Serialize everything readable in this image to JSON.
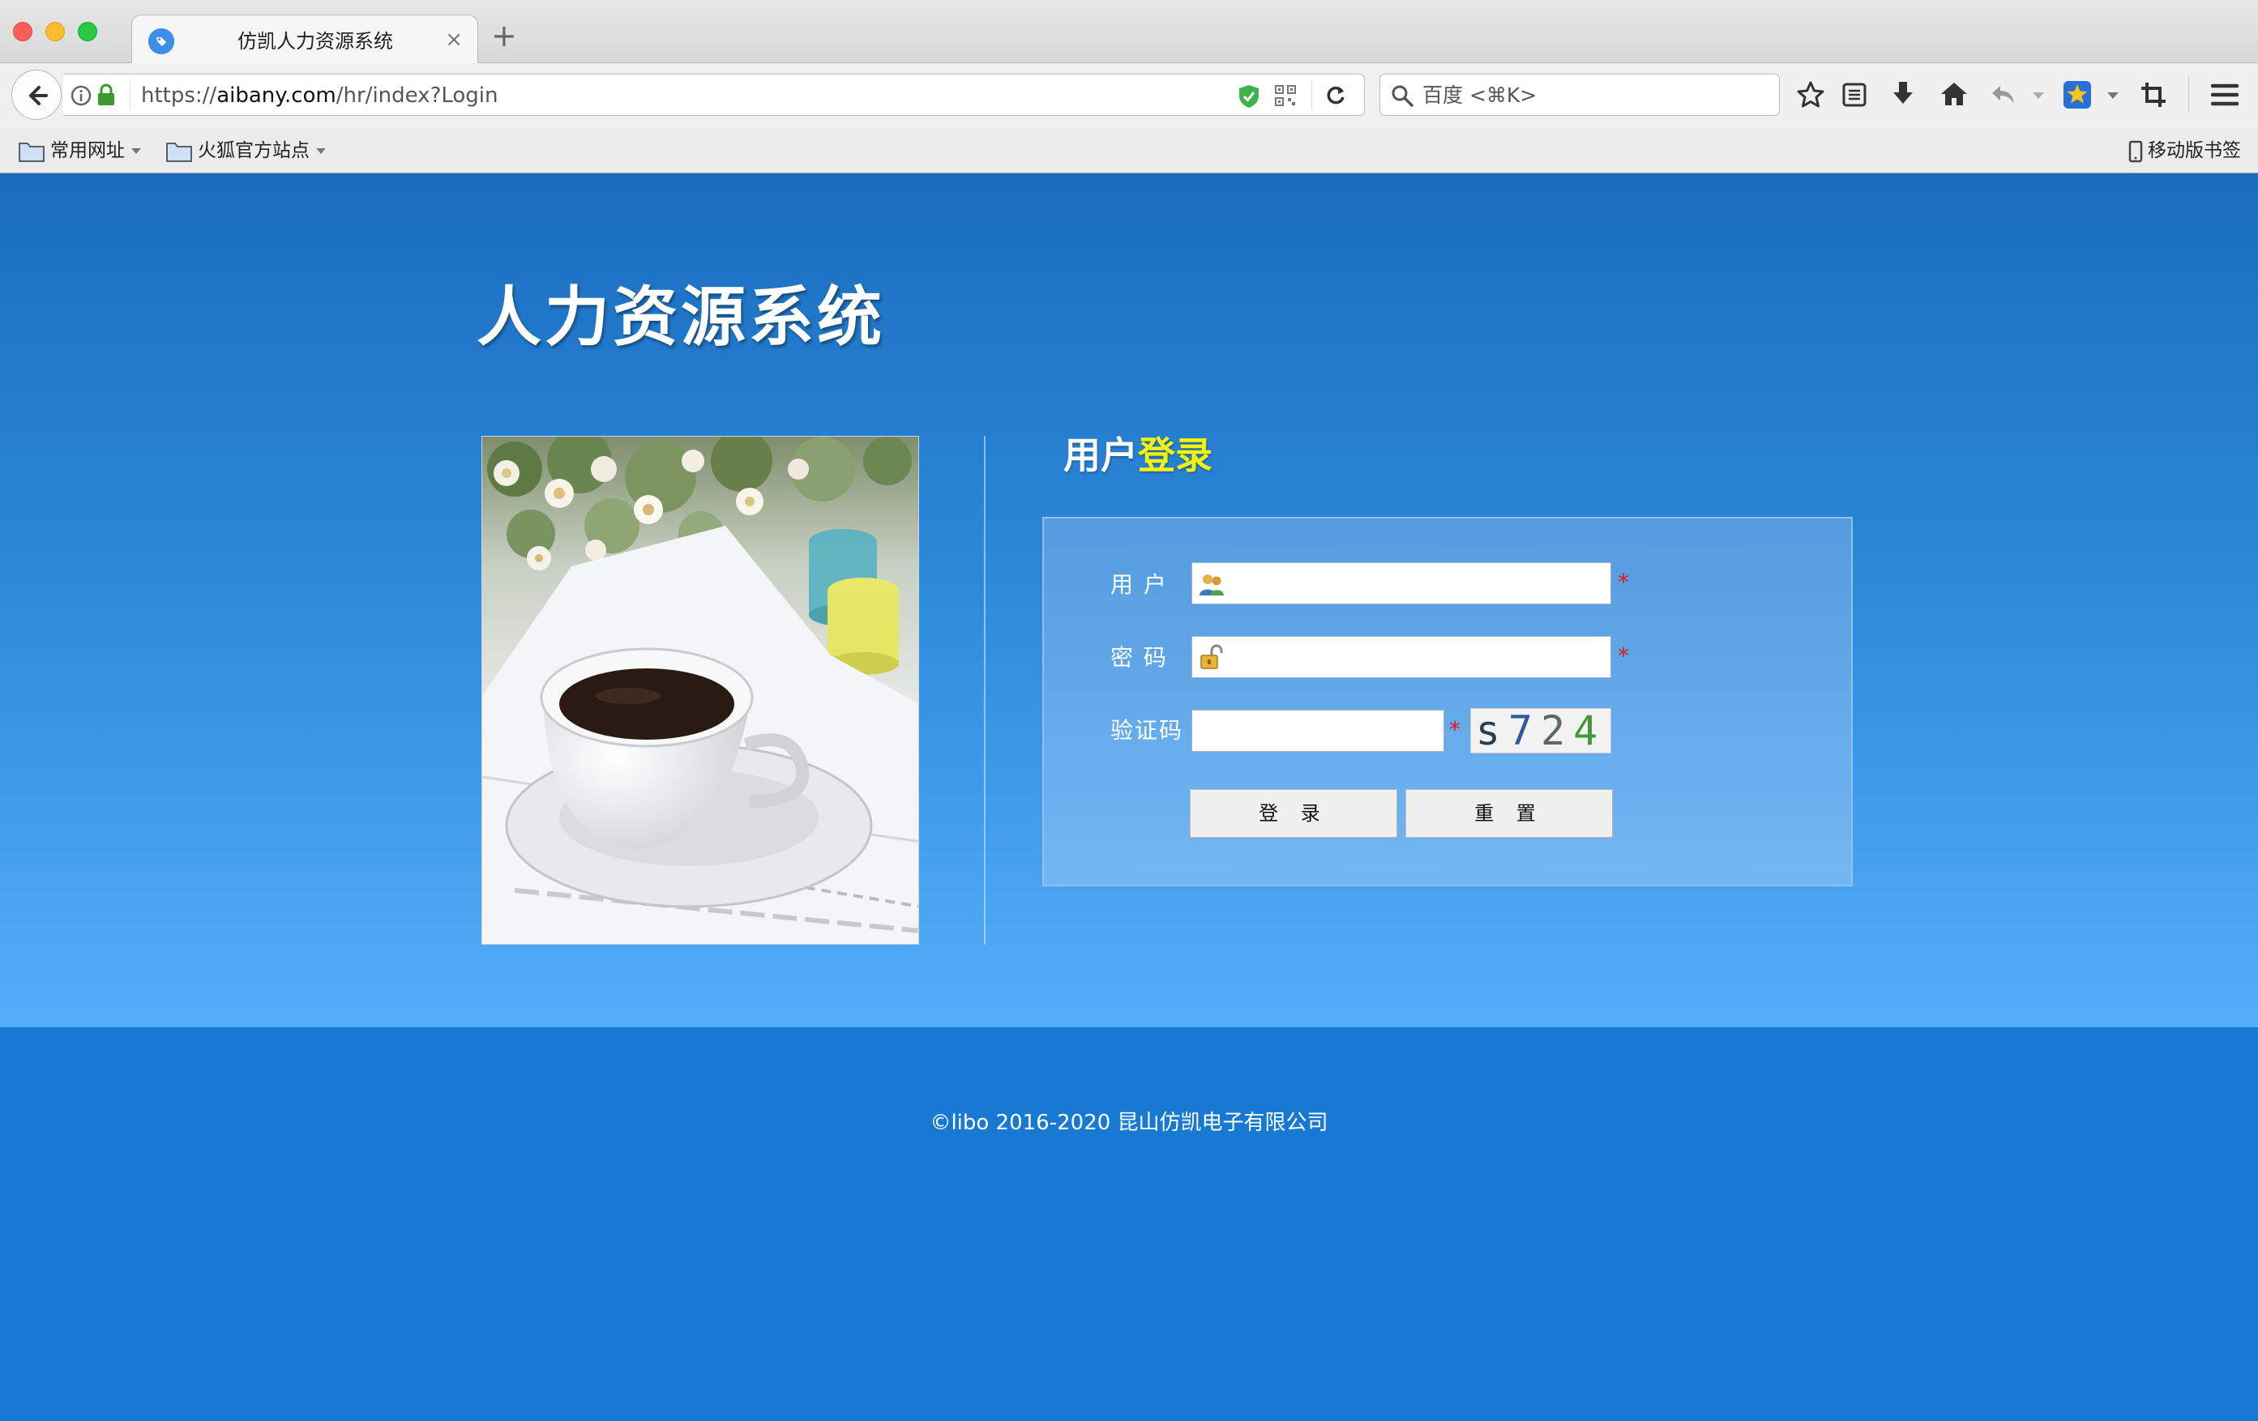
{
  "browser": {
    "tab_title": "仿凯人力资源系统",
    "tab_close": "×",
    "new_tab": "+",
    "url_prefix": "https://",
    "url_domain": "aibany.com",
    "url_path": "/hr/index?Login",
    "search_placeholder": "百度 <⌘K>",
    "bookmarks": [
      {
        "label": "常用网址"
      },
      {
        "label": "火狐官方站点"
      }
    ],
    "mobile_bookmarks": "移动版书签"
  },
  "page": {
    "app_title": "人力资源系统",
    "login_heading_part1": "用户",
    "login_heading_part2": "登录",
    "fields": {
      "username_label": "用 户",
      "password_label": "密 码",
      "captcha_label": "验证码",
      "required_mark": "*"
    },
    "captcha": {
      "c1": "s",
      "c2": "7",
      "c3": "2",
      "c4": "4"
    },
    "buttons": {
      "login": "登 录",
      "reset": "重 置"
    },
    "footer_text": "©libo 2016-2020 昆山仿凯电子有限公司"
  },
  "colors": {
    "heading_highlight": "#f2f20c",
    "required": "#e01919",
    "footer_bg": "#1879d2"
  }
}
